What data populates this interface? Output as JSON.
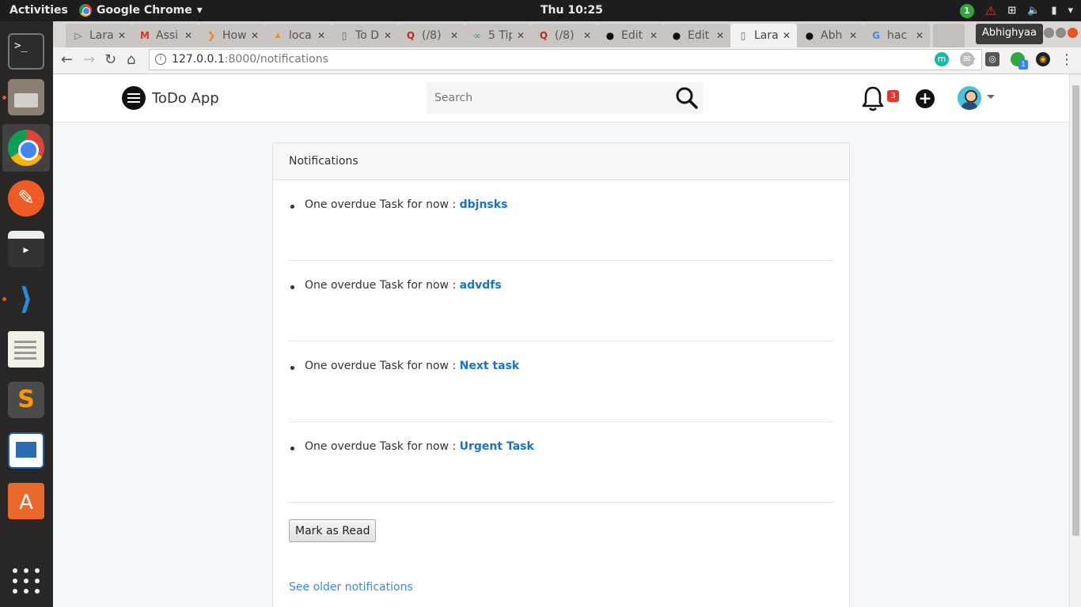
{
  "system": {
    "activities": "Activities",
    "app_menu": "Google Chrome",
    "clock": "Thu 10:25",
    "tray_badge": "1"
  },
  "browser": {
    "tabs": [
      {
        "title": "Lara",
        "icon": "laravel-icon"
      },
      {
        "title": "Assi",
        "icon": "gmail-icon"
      },
      {
        "title": "How",
        "icon": "stackoverflow-icon"
      },
      {
        "title": "loca",
        "icon": "phpmyadmin-icon"
      },
      {
        "title": "To D",
        "icon": "page-icon"
      },
      {
        "title": "(/8)",
        "icon": "quora-icon"
      },
      {
        "title": "5 Tip",
        "icon": "link-icon"
      },
      {
        "title": "(/8)",
        "icon": "quora-icon"
      },
      {
        "title": "Edit",
        "icon": "github-icon"
      },
      {
        "title": "Edit",
        "icon": "github-icon"
      },
      {
        "title": "Lara",
        "icon": "page-icon",
        "active": true
      },
      {
        "title": "Abh",
        "icon": "github-icon"
      },
      {
        "title": "hac",
        "icon": "google-icon"
      }
    ],
    "profile_name": "Abhighyaa",
    "url_host": "127.0.0.1",
    "url_path": ":8000/notifications",
    "ext_badge": "1"
  },
  "app": {
    "brand": "ToDo App",
    "search_placeholder": "Search",
    "notification_count": "3"
  },
  "notifications": {
    "header": "Notifications",
    "prefix": "One overdue Task for now : ",
    "items": [
      {
        "task": "dbjnsks"
      },
      {
        "task": "advdfs"
      },
      {
        "task": "Next task"
      },
      {
        "task": "Urgent Task"
      }
    ],
    "mark_read_label": "Mark as Read",
    "older_link": "See older notifications"
  },
  "colors": {
    "link": "#1a73c7",
    "badge": "#e3342f",
    "ubuntu_orange": "#e95420"
  }
}
